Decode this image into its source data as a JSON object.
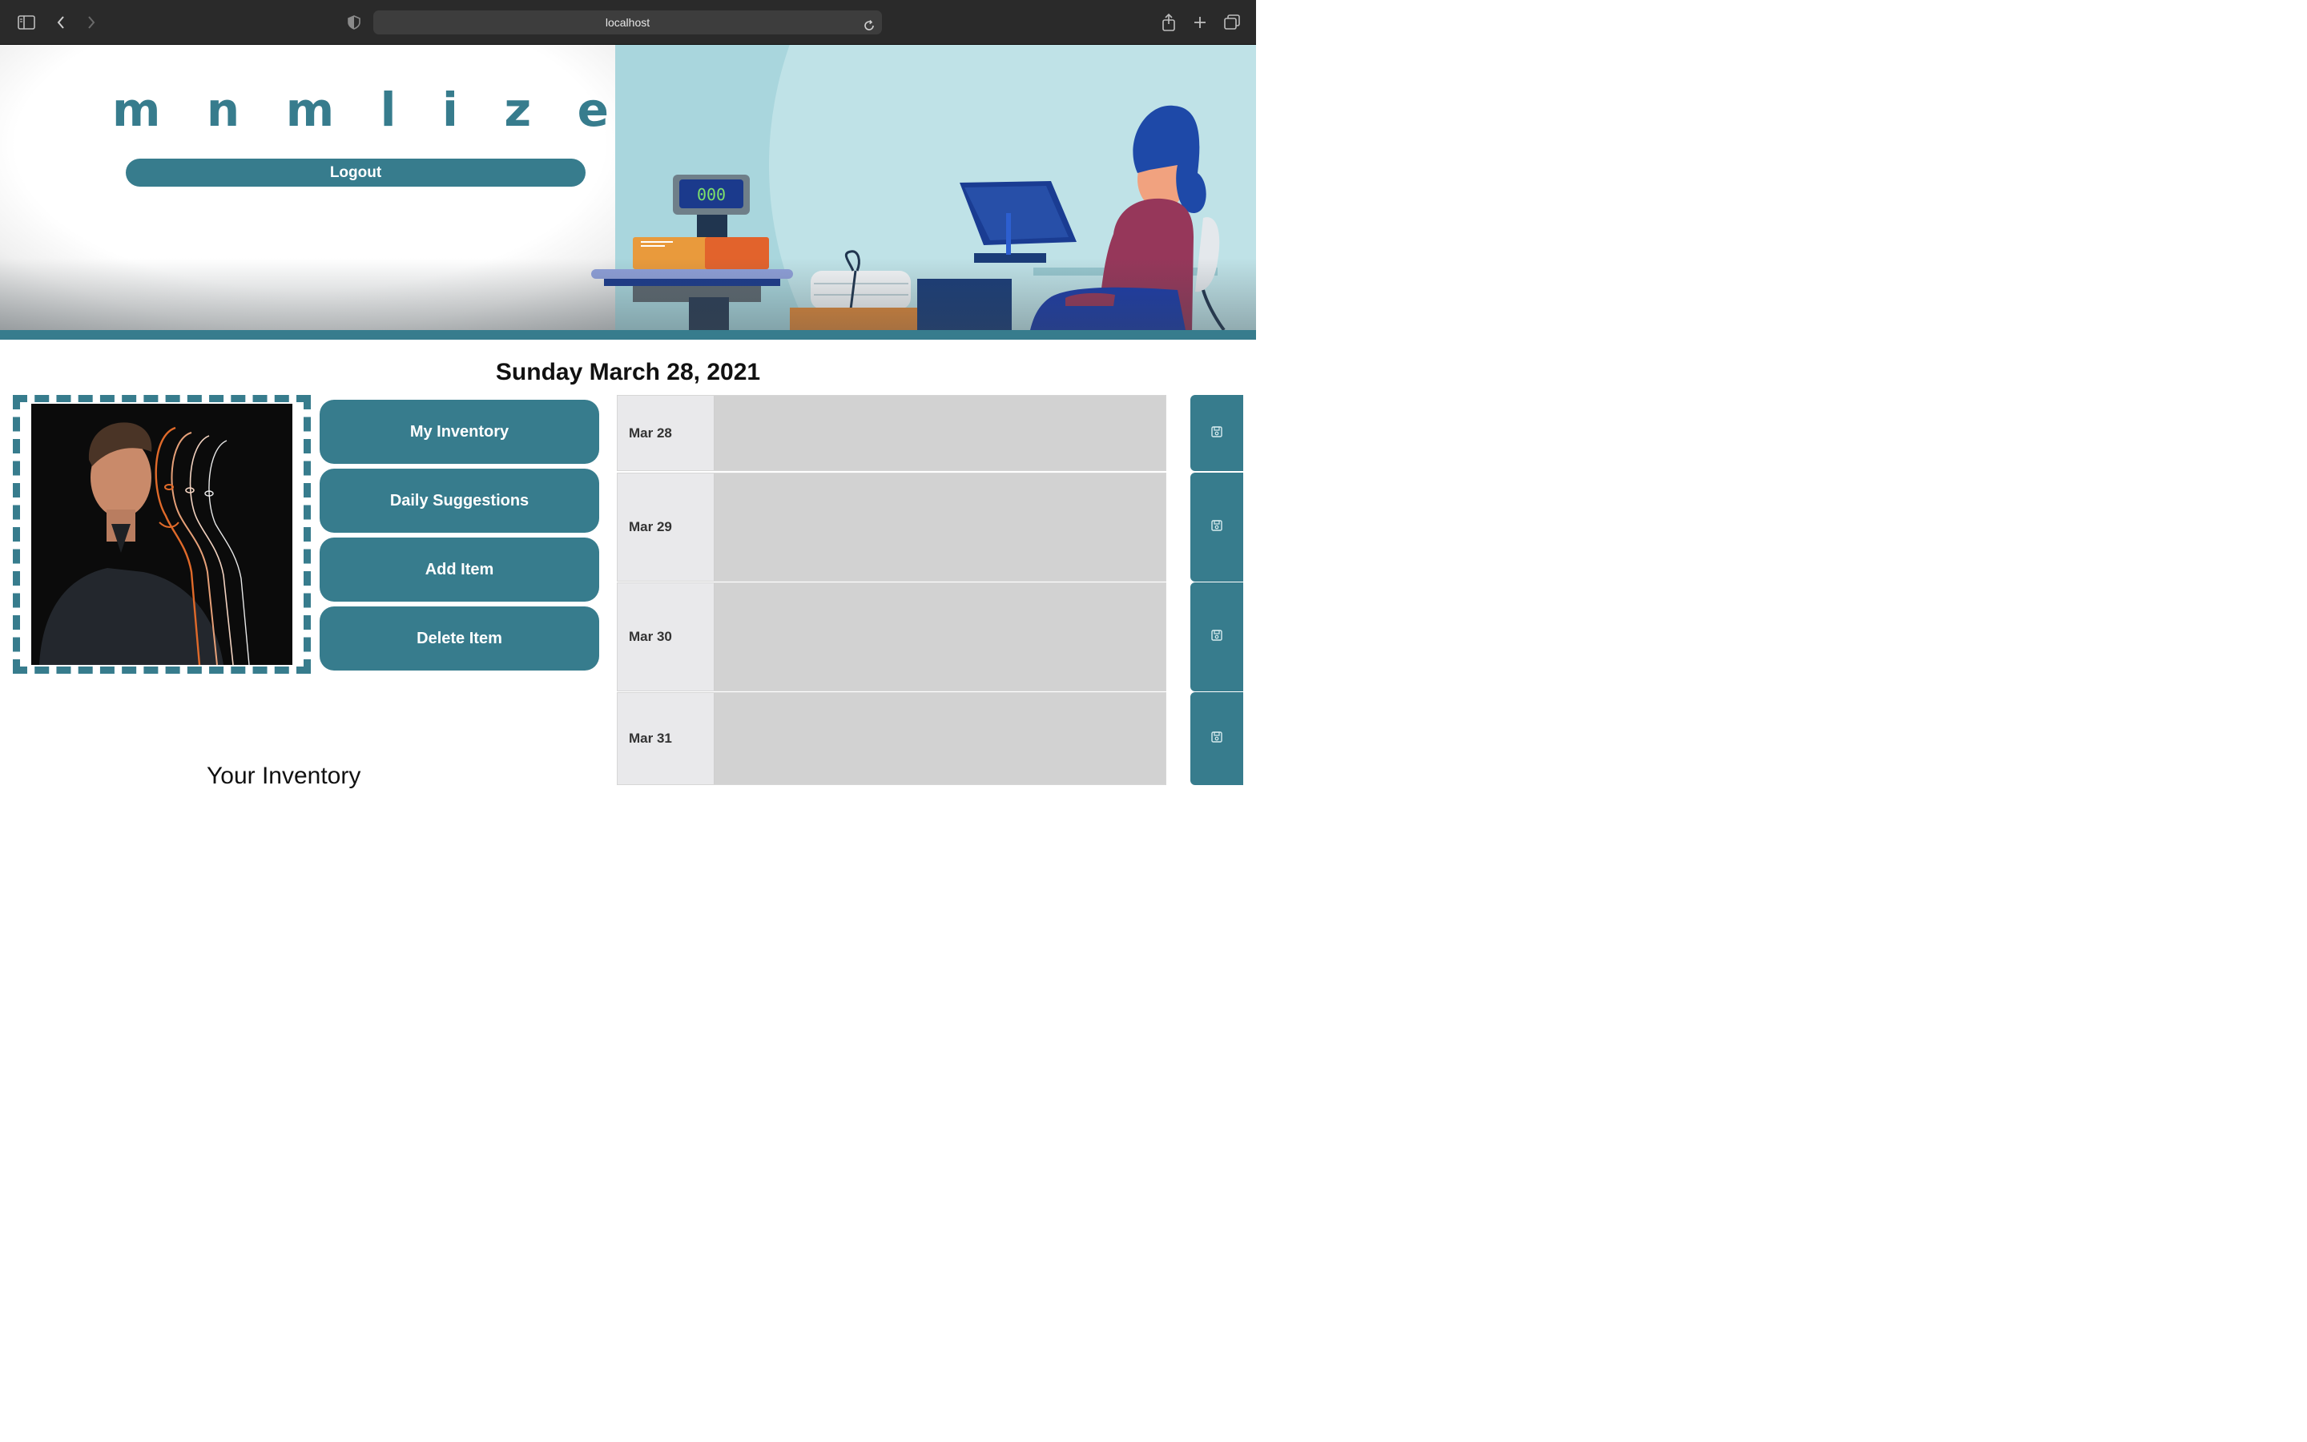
{
  "browser": {
    "url": "localhost"
  },
  "header": {
    "logo_letters": [
      "m",
      "n",
      "m",
      "l",
      "i",
      "z",
      "e"
    ],
    "logout_label": "Logout"
  },
  "main": {
    "date_heading": "Sunday March 28, 2021",
    "nav_buttons": [
      {
        "label": "My Inventory"
      },
      {
        "label": "Daily Suggestions"
      },
      {
        "label": "Add Item"
      },
      {
        "label": "Delete Item"
      }
    ],
    "inventory_title": "Your Inventory",
    "days": [
      {
        "label": "Mar 28",
        "value": ""
      },
      {
        "label": "Mar 29",
        "value": ""
      },
      {
        "label": "Mar 30",
        "value": ""
      },
      {
        "label": "Mar 31",
        "value": ""
      }
    ]
  },
  "colors": {
    "accent": "#377c8d",
    "chrome": "#2a2a2a",
    "day_area": "#d2d2d2"
  }
}
